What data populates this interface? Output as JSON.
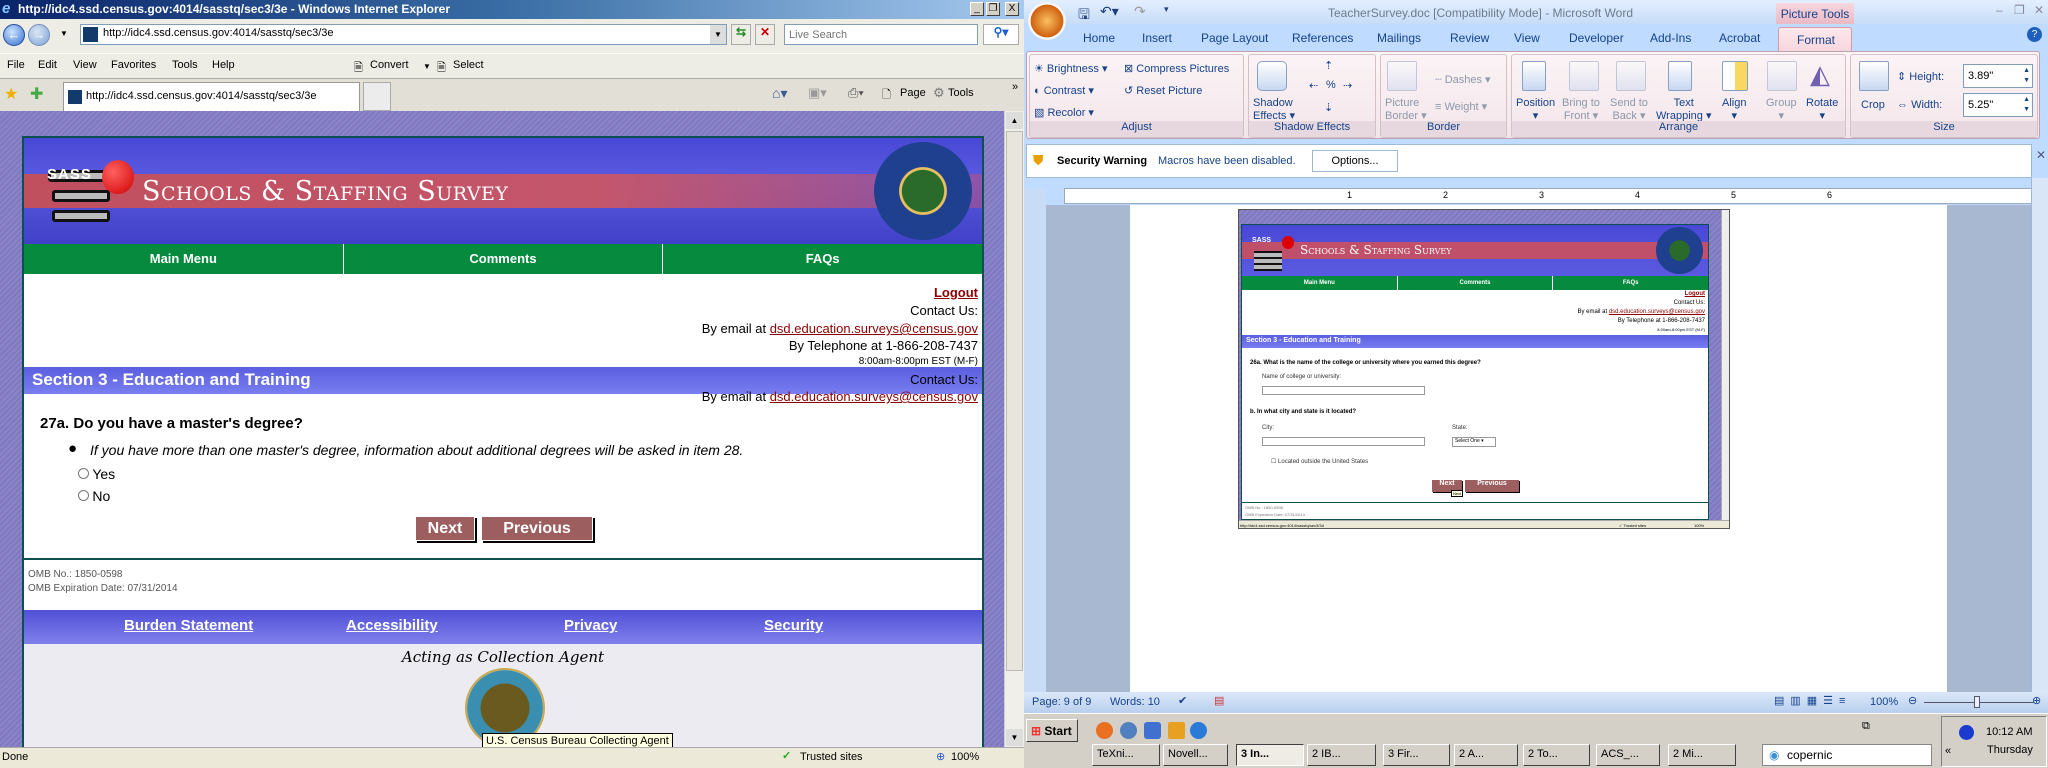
{
  "ie": {
    "title": "http://idc4.ssd.census.gov:4014/sasstq/sec3/3e - Windows Internet Explorer",
    "address": "http://idc4.ssd.census.gov:4014/sasstq/sec3/3e",
    "search_placeholder": "Live Search",
    "menu": [
      "File",
      "Edit",
      "View",
      "Favorites",
      "Tools",
      "Help"
    ],
    "convert": "Convert",
    "select": "Select",
    "tab_title": "http://idc4.ssd.census.gov:4014/sasstq/sec3/3e",
    "page_menu": "Page",
    "tools_menu": "Tools",
    "status": "Done",
    "zone": "Trusted sites",
    "zoom": "100%"
  },
  "page": {
    "sass": "SASS",
    "title": "Schools & Staffing Survey",
    "nav": [
      "Main Menu",
      "Comments",
      "FAQs"
    ],
    "logout": "Logout",
    "contact_us": "Contact Us:",
    "email_prefix": "By email at",
    "email": "dsd.education.surveys@census.gov",
    "phone": "By Telephone at 1-866-208-7437",
    "hours": "8:00am-8:00pm EST (M-F)",
    "section": "Section 3 - Education and Training",
    "question": "27a. Do you have a master's degree?",
    "note": "If you have more than one master's degree, information about additional degrees will be asked in item 28.",
    "options": [
      "Yes",
      "No"
    ],
    "next": "Next",
    "previous": "Previous",
    "omb_no": "OMB No.: 1850-0598",
    "omb_exp": "OMB Expiration Date: 07/31/2014",
    "footer_links": [
      "Burden Statement",
      "Accessibility",
      "Privacy",
      "Security"
    ],
    "acting": "Acting as Collection Agent",
    "tooltip": "U.S. Census Bureau Collecting Agent"
  },
  "word": {
    "title": "TeacherSurvey.doc [Compatibility Mode] - Microsoft Word",
    "contextual": "Picture Tools",
    "tabs": [
      "Home",
      "Insert",
      "Page Layout",
      "References",
      "Mailings",
      "Review",
      "View",
      "Developer",
      "Add-Ins",
      "Acrobat",
      "Format"
    ],
    "ribbon": {
      "adjust": {
        "label": "Adjust",
        "brightness": "Brightness",
        "contrast": "Contrast",
        "recolor": "Recolor",
        "compress": "Compress Pictures",
        "reset": "Reset Picture"
      },
      "shadow": {
        "label": "Shadow Effects",
        "button1": "Shadow",
        "button2": "Effects"
      },
      "border": {
        "label": "Border",
        "picture1": "Picture",
        "picture2": "Border",
        "dashes": "Dashes",
        "weight": "Weight"
      },
      "arrange": {
        "label": "Arrange",
        "items": [
          [
            "Position",
            ""
          ],
          [
            "Bring to",
            "Front"
          ],
          [
            "Send to",
            "Back"
          ],
          [
            "Text",
            "Wrapping"
          ],
          [
            "Align",
            ""
          ],
          [
            "Group",
            ""
          ],
          [
            "Rotate",
            ""
          ]
        ]
      },
      "size": {
        "label": "Size",
        "crop": "Crop",
        "height_label": "Height:",
        "height": "3.89\"",
        "width_label": "Width:",
        "width": "5.25\""
      }
    },
    "security": {
      "title": "Security Warning",
      "message": "Macros have been disabled.",
      "options": "Options..."
    },
    "ruler": [
      "1",
      "2",
      "3",
      "4",
      "5",
      "6"
    ],
    "status": {
      "page": "Page: 9 of 9",
      "words": "Words: 10",
      "zoom": "100%"
    }
  },
  "embedded": {
    "sass": "SASS",
    "title": "Schools & Staffing Survey",
    "nav": [
      "Main Menu",
      "Comments",
      "FAQs"
    ],
    "logout": "Logout",
    "contact_us": "Contact Us:",
    "email_prefix": "By email at",
    "email": "dsd.education.surveys@census.gov",
    "phone": "By Telephone at 1-866-208-7437",
    "hours": "8:00am-8:00pm EST (M-F)",
    "section": "Section 3 - Education and Training",
    "q26a": "26a. What is the name of the college or university where you earned this degree?",
    "name_label": "Name of college or university:",
    "q26b": "b. In what city and state is it located?",
    "city": "City:",
    "state": "State:",
    "state_select": "Select One",
    "outside": "Located outside the United States",
    "next": "Next",
    "previous": "Previous",
    "tooltip": "Next",
    "omb_no": "OMB No.: 1850-0598",
    "omb_exp": "OMB Expiration Date: 07/31/2014",
    "status_url": "http://idc4.ssd.census.gov:4014/sasstq/sec3/3d",
    "zone": "Trusted sites",
    "zoom": "100%"
  },
  "taskbar": {
    "start": "Start",
    "tasks": [
      "TeXni...",
      "Novell...",
      "3 In...",
      "2 IB...",
      "3 Fir...",
      "2 A...",
      "2 To...",
      "ACS_...",
      "2 Mi..."
    ],
    "search": "copernic",
    "time": "10:12 AM",
    "day": "Thursday"
  }
}
